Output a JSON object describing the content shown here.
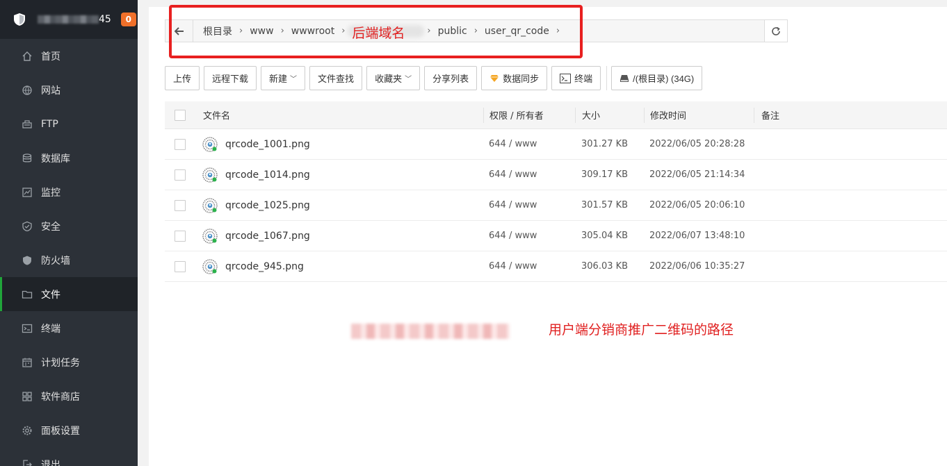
{
  "sidebar": {
    "host_suffix": "45",
    "badge": "0",
    "items": [
      {
        "label": "首页",
        "icon": "home-icon"
      },
      {
        "label": "网站",
        "icon": "globe-icon"
      },
      {
        "label": "FTP",
        "icon": "ftp-icon"
      },
      {
        "label": "数据库",
        "icon": "database-icon"
      },
      {
        "label": "监控",
        "icon": "monitor-icon"
      },
      {
        "label": "安全",
        "icon": "shield-check-icon"
      },
      {
        "label": "防火墙",
        "icon": "firewall-icon"
      },
      {
        "label": "文件",
        "icon": "folder-icon"
      },
      {
        "label": "终端",
        "icon": "terminal-icon"
      },
      {
        "label": "计划任务",
        "icon": "calendar-icon"
      },
      {
        "label": "软件商店",
        "icon": "apps-icon"
      },
      {
        "label": "面板设置",
        "icon": "gear-icon"
      },
      {
        "label": "退出",
        "icon": "logout-icon"
      }
    ],
    "active_index": 7
  },
  "path": {
    "crumbs": [
      "根目录",
      "www",
      "wwwroot"
    ],
    "annotation": "后端域名",
    "crumbs_after": [
      "public",
      "user_qr_code"
    ]
  },
  "toolbar": {
    "upload": "上传",
    "remote_download": "远程下载",
    "new": "新建",
    "find": "文件查找",
    "favorites": "收藏夹",
    "share_list": "分享列表",
    "sync": "数据同步",
    "terminal": "终端",
    "disk": "/(根目录) (34G)"
  },
  "table": {
    "headers": {
      "name": "文件名",
      "perm": "权限 / 所有者",
      "size": "大小",
      "time": "修改时间",
      "note": "备注"
    },
    "rows": [
      {
        "name": "qrcode_1001.png",
        "perm": "644 / www",
        "size": "301.27 KB",
        "time": "2022/06/05 20:28:28",
        "note": ""
      },
      {
        "name": "qrcode_1014.png",
        "perm": "644 / www",
        "size": "309.17 KB",
        "time": "2022/06/05 21:14:34",
        "note": ""
      },
      {
        "name": "qrcode_1025.png",
        "perm": "644 / www",
        "size": "301.57 KB",
        "time": "2022/06/05 20:06:10",
        "note": ""
      },
      {
        "name": "qrcode_1067.png",
        "perm": "644 / www",
        "size": "305.04 KB",
        "time": "2022/06/07 13:48:10",
        "note": ""
      },
      {
        "name": "qrcode_945.png",
        "perm": "644 / www",
        "size": "306.03 KB",
        "time": "2022/06/06 10:35:27",
        "note": ""
      }
    ]
  },
  "annotation": {
    "note": "用户端分销商推广二维码的路径"
  },
  "colors": {
    "accent": "#20a53a",
    "badge": "#f0702a",
    "annotation": "#e02020"
  }
}
